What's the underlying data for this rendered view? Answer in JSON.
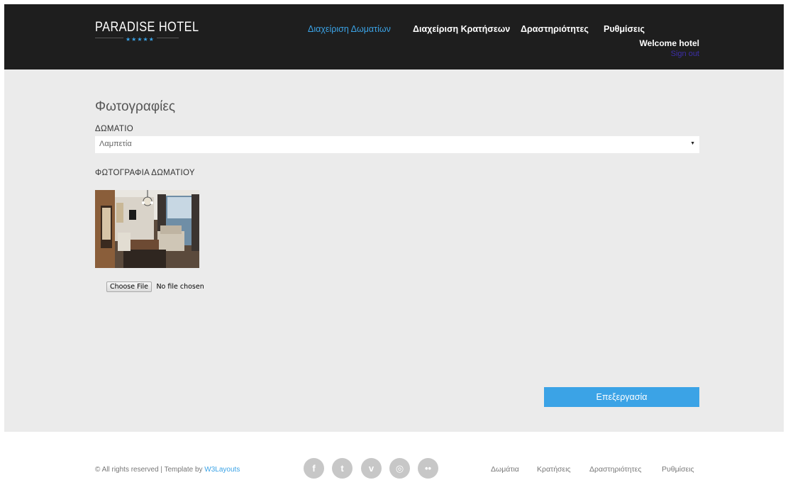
{
  "brand": {
    "name": "PARADISE HOTEL",
    "stars": "★★★★★"
  },
  "nav": {
    "items": [
      {
        "label": "Διαχείριση Δωματίων",
        "active": true
      },
      {
        "label": "Διαχείριση Κρατήσεων",
        "active": false
      },
      {
        "label": "Δραστηριότητες",
        "active": false
      },
      {
        "label": "Ρυθμίσεις",
        "active": false
      }
    ]
  },
  "user": {
    "welcome": "Welcome hotel",
    "signout": "Sign out"
  },
  "main": {
    "title": "Φωτογραφίες",
    "room_label": "ΔΩΜΑΤΙΟ",
    "room_selected": "Λαμπετία",
    "photo_label": "ΦΩΤΟΓΡΑΦΙΑ ΔΩΜΑΤΙΟΥ",
    "file_button": "Choose File",
    "file_status": "No file chosen",
    "edit_button": "Επεξεργασία"
  },
  "footer": {
    "copyright": "© All rights reserved | Template by ",
    "template_link": "W3Layouts",
    "social": [
      {
        "icon": "facebook-icon",
        "glyph": "f"
      },
      {
        "icon": "twitter-icon",
        "glyph": "t"
      },
      {
        "icon": "vimeo-icon",
        "glyph": "v"
      },
      {
        "icon": "dribbble-icon",
        "glyph": "◎"
      },
      {
        "icon": "flickr-icon",
        "glyph": "••"
      }
    ],
    "links": [
      "Δωμάτια",
      "Κρατήσεις",
      "Δραστηριότητες",
      "Ρυθμίσεις"
    ]
  },
  "colors": {
    "accent": "#3ba3e6",
    "header": "#1e1e1e",
    "content_bg": "#ebebeb",
    "signout": "#3d2fa8"
  }
}
